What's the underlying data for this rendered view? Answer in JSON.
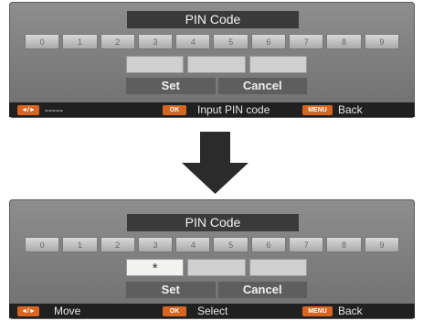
{
  "screen1": {
    "title": "PIN Code",
    "digits": [
      "0",
      "1",
      "2",
      "3",
      "4",
      "5",
      "6",
      "7",
      "8",
      "9"
    ],
    "pin_boxes": [
      "",
      "",
      ""
    ],
    "set_label": "Set",
    "cancel_label": "Cancel",
    "status": {
      "left_badge": "◄/►",
      "left_text": "-----",
      "mid_badge": "OK",
      "mid_text": "Input PIN code",
      "right_badge": "MENU",
      "right_text": "Back"
    }
  },
  "arrow_icon": "down-arrow-icon",
  "screen2": {
    "title": "PIN Code",
    "digits": [
      "0",
      "1",
      "2",
      "3",
      "4",
      "5",
      "6",
      "7",
      "8",
      "9"
    ],
    "pin_boxes": [
      "*",
      "",
      ""
    ],
    "set_label": "Set",
    "cancel_label": "Cancel",
    "status": {
      "left_badge": "◄/►",
      "left_text": "Move",
      "mid_badge": "OK",
      "mid_text": "Select",
      "right_badge": "MENU",
      "right_text": "Back"
    }
  },
  "colors": {
    "panel": "#7f7f7f",
    "title_bar": "#3a3a3a",
    "status_bar": "#202020",
    "badge": "#d86520",
    "arrow": "#2b2b2b"
  }
}
